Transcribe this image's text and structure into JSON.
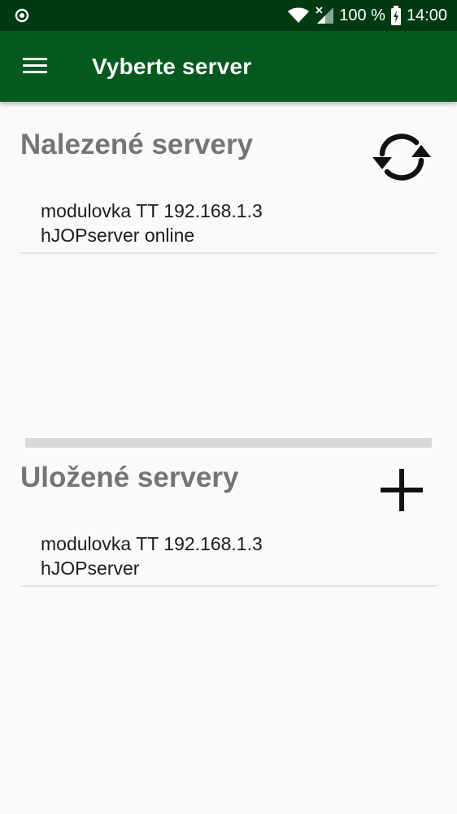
{
  "status_bar": {
    "battery": "100 %",
    "time": "14:00",
    "icons": [
      "target-icon",
      "wifi-icon",
      "signal-icon",
      "battery-charging-icon"
    ]
  },
  "app_bar": {
    "title": "Vyberte server",
    "menu_icon": "hamburger-menu-icon"
  },
  "found_servers": {
    "title": "Nalezené servery",
    "action_icon": "refresh-icon",
    "items": [
      {
        "line1": "modulovka TT 192.168.1.3",
        "line2": "hJOPserver online"
      }
    ]
  },
  "saved_servers": {
    "title": "Uložené servery",
    "action_icon": "plus-icon",
    "items": [
      {
        "line1": "modulovka TT 192.168.1.3",
        "line2": "hJOPserver"
      }
    ]
  },
  "colors": {
    "status_bar": "#003a12",
    "app_bar": "#05591f",
    "background": "#fafafa",
    "section_title": "#757575"
  }
}
